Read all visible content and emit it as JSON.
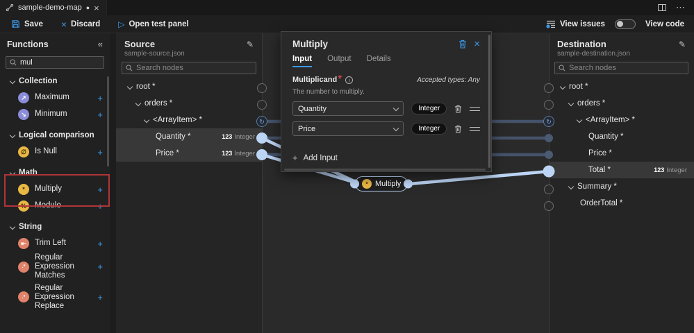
{
  "titlebar": {
    "tab_label": "sample-demo-map",
    "modified_dot": "●",
    "close": "×",
    "more": "⋯"
  },
  "commandbar": {
    "save": "Save",
    "discard": "Discard",
    "discard_glyph": "×",
    "open_test_panel": "Open test panel",
    "play_glyph": "▷",
    "view_issues": "View issues",
    "view_code": "View code"
  },
  "functions_panel": {
    "title": "Functions",
    "collapse_glyph": "«",
    "search_value": "mul",
    "add_glyph": "+",
    "groups": [
      {
        "label": "Collection",
        "items": [
          {
            "label": "Maximum",
            "glyph": "↗",
            "color": "#8b8ddb"
          },
          {
            "label": "Minimum",
            "glyph": "↘",
            "color": "#8b8ddb"
          }
        ]
      },
      {
        "label": "Logical comparison",
        "items": [
          {
            "label": "Is Null",
            "glyph": "∅",
            "color": "#e9b844"
          }
        ]
      },
      {
        "label": "Math",
        "items": [
          {
            "label": "Multiply",
            "glyph": "*",
            "color": "#e9b844"
          },
          {
            "label": "Modulo",
            "glyph": "%",
            "color": "#e9b844"
          }
        ]
      },
      {
        "label": "String",
        "items": [
          {
            "label": "Trim Left",
            "glyph": "⇤",
            "color": "#e0836a"
          },
          {
            "label": "Regular Expression Matches",
            "glyph": ".*",
            "color": "#e0836a"
          },
          {
            "label": "Regular Expression Replace",
            "glyph": ".*",
            "color": "#e0836a"
          }
        ]
      }
    ]
  },
  "source_panel": {
    "title": "Source",
    "subtitle": "sample-source.json",
    "edit_glyph": "✎",
    "search_placeholder": "Search nodes",
    "nodes": [
      {
        "label": "root *"
      },
      {
        "label": "orders *"
      },
      {
        "label": "<ArrayItem> *"
      },
      {
        "label": "Quantity *",
        "type_num": "123",
        "type_name": "Integer"
      },
      {
        "label": "Price *",
        "type_num": "123",
        "type_name": "Integer"
      }
    ]
  },
  "dest_panel": {
    "title": "Destination",
    "subtitle": "sample-destination.json",
    "edit_glyph": "✎",
    "search_placeholder": "Search nodes",
    "nodes": [
      {
        "label": "root *"
      },
      {
        "label": "orders *"
      },
      {
        "label": "<ArrayItem> *"
      },
      {
        "label": "Quantity *"
      },
      {
        "label": "Price *"
      },
      {
        "label": "Total *",
        "type_num": "123",
        "type_name": "Integer"
      },
      {
        "label": "Summary *"
      },
      {
        "label": "OrderTotal *"
      }
    ]
  },
  "dialog": {
    "title": "Multiply",
    "close_glyph": "×",
    "tabs": {
      "input": "Input",
      "output": "Output",
      "details": "Details"
    },
    "field_label": "Multiplicand",
    "required_mark": "*",
    "info_glyph": "i",
    "accepted_types": "Accepted types: Any",
    "field_desc": "The number to multiply.",
    "inputs": [
      {
        "value": "Quantity",
        "type": "Integer"
      },
      {
        "value": "Price",
        "type": "Integer"
      }
    ],
    "add_input_plus": "+",
    "add_input_label": "Add Input"
  },
  "canvas": {
    "node_label": "Multiply",
    "node_glyph": "*",
    "node_color": "#e9b844"
  },
  "colors": {
    "accent_blue": "#3d99e8",
    "wire_active": "#bdd5f5",
    "wire_inactive": "#45536a",
    "highlight_red": "#b13437",
    "row_highlight": "#383838"
  }
}
